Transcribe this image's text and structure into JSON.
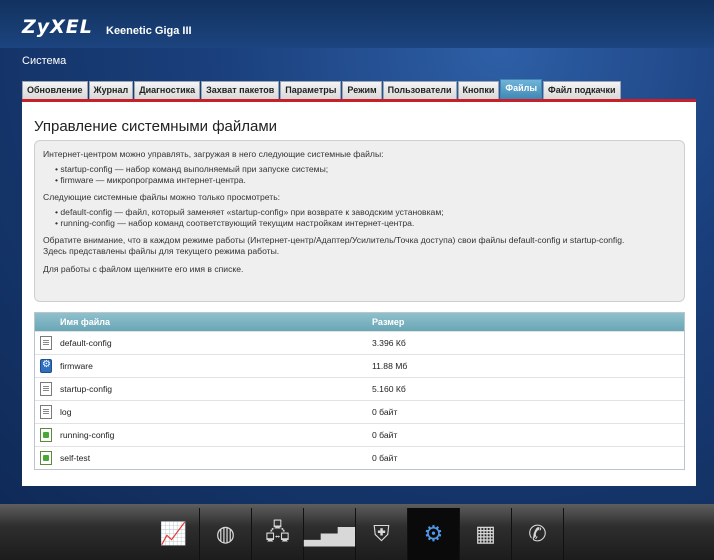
{
  "header": {
    "brand": "ZyXEL",
    "model": "Keenetic Giga III",
    "section": "Система"
  },
  "tabs": [
    {
      "label": "Обновление"
    },
    {
      "label": "Журнал"
    },
    {
      "label": "Диагностика"
    },
    {
      "label": "Захват пакетов"
    },
    {
      "label": "Параметры"
    },
    {
      "label": "Режим"
    },
    {
      "label": "Пользователи"
    },
    {
      "label": "Кнопки"
    },
    {
      "label": "Файлы",
      "active": true
    },
    {
      "label": "Файл подкачки"
    }
  ],
  "panel": {
    "title": "Управление системными файлами",
    "info": {
      "p1": "Интернет-центром можно управлять, загружая в него следующие системные файлы:",
      "list1": [
        "startup-config — набор команд выполняемый при запуске системы;",
        "firmware — микропрограмма интернет-центра."
      ],
      "p2": "Следующие системные файлы можно только просмотреть:",
      "list2": [
        "default-config — файл, который заменяет «startup-config» при возврате к заводским установкам;",
        "running-config — набор команд соответствующий текущим настройкам интернет-центра."
      ],
      "p3": "Обратите внимание, что в каждом режиме работы (Интернет-центр/Адаптер/Усилитель/Точка доступа) свои файлы default-config и startup-config.",
      "p3b": "Здесь представлены файлы для текущего режима работы.",
      "p4": "Для работы с файлом щелкните его имя в списке."
    },
    "table": {
      "col_name": "Имя файла",
      "col_size": "Размер",
      "rows": [
        {
          "name": "default-config",
          "size": "3.396 Кб",
          "icon": "document-icon"
        },
        {
          "name": "firmware",
          "size": "11.88 Мб",
          "icon": "firmware-gear-icon"
        },
        {
          "name": "startup-config",
          "size": "5.160 Кб",
          "icon": "document-icon"
        },
        {
          "name": "log",
          "size": "0 байт",
          "icon": "document-icon"
        },
        {
          "name": "running-config",
          "size": "0 байт",
          "icon": "running-document-icon"
        },
        {
          "name": "self-test",
          "size": "0 байт",
          "icon": "running-document-icon"
        }
      ]
    }
  },
  "taskbar": [
    {
      "icon": "monitor-chart-icon"
    },
    {
      "icon": "globe-icon"
    },
    {
      "icon": "network-computers-icon"
    },
    {
      "icon": "signal-bars-icon"
    },
    {
      "icon": "shield-icon"
    },
    {
      "icon": "settings-gear-icon",
      "active": true
    },
    {
      "icon": "apps-grid-icon"
    },
    {
      "icon": "phone-chat-icon"
    }
  ]
}
